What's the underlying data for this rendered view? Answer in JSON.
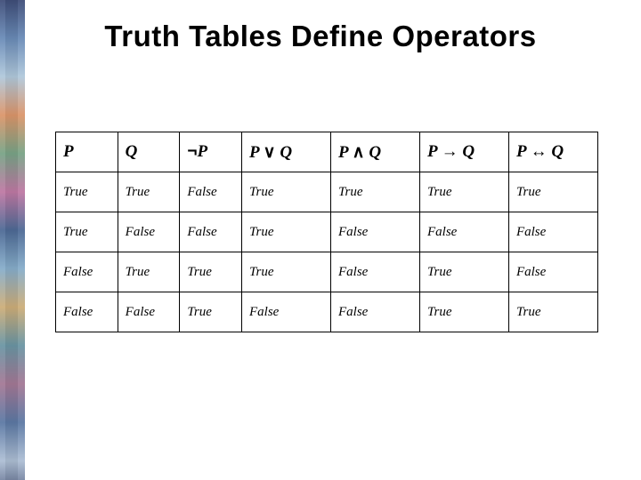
{
  "title": "Truth Tables Define Operators",
  "headers": {
    "p": "P",
    "q": "Q",
    "not_p_prefix": "¬",
    "not_p_suffix": "P",
    "or_left": "P ",
    "or_sym": "∨",
    "or_right": " Q",
    "and_left": "P ",
    "and_sym": "∧",
    "and_right": " Q",
    "imp_left": "P ",
    "imp_sym": "→",
    "imp_right": " Q",
    "iff_left": "P ",
    "iff_sym": "↔",
    "iff_right": " Q"
  },
  "chart_data": {
    "type": "table",
    "columns": [
      "P",
      "Q",
      "¬P",
      "P ∨ Q",
      "P ∧ Q",
      "P → Q",
      "P ↔ Q"
    ],
    "rows": [
      [
        "True",
        "True",
        "False",
        "True",
        "True",
        "True",
        "True"
      ],
      [
        "True",
        "False",
        "False",
        "True",
        "False",
        "False",
        "False"
      ],
      [
        "False",
        "True",
        "True",
        "True",
        "False",
        "True",
        "False"
      ],
      [
        "False",
        "False",
        "True",
        "False",
        "False",
        "True",
        "True"
      ]
    ]
  }
}
